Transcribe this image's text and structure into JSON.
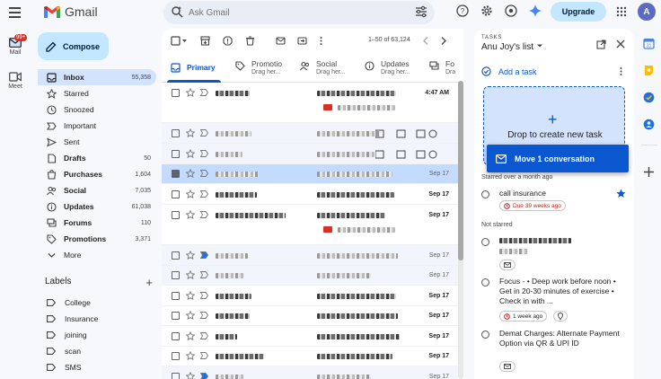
{
  "app": {
    "logo_text": "Gmail",
    "avatar_letter": "A",
    "upgrade_label": "Upgrade"
  },
  "search": {
    "placeholder": "Ask Gmail"
  },
  "rail": {
    "mail_label": "Mail",
    "mail_badge": "99+",
    "meet_label": "Meet"
  },
  "compose_label": "Compose",
  "nav": [
    {
      "label": "Inbox",
      "count": "55,358",
      "icon": "inbox-icon",
      "active": true
    },
    {
      "label": "Starred",
      "count": "",
      "icon": "star-icon"
    },
    {
      "label": "Snoozed",
      "count": "",
      "icon": "clock-icon"
    },
    {
      "label": "Important",
      "count": "",
      "icon": "important-icon"
    },
    {
      "label": "Sent",
      "count": "",
      "icon": "send-icon"
    },
    {
      "label": "Drafts",
      "count": "50",
      "icon": "draft-icon",
      "bold": true
    },
    {
      "label": "Purchases",
      "count": "1,604",
      "icon": "purchases-icon",
      "bold": true
    },
    {
      "label": "Social",
      "count": "7,035",
      "icon": "social-icon",
      "bold": true
    },
    {
      "label": "Updates",
      "count": "61,038",
      "icon": "updates-icon",
      "bold": true
    },
    {
      "label": "Forums",
      "count": "110",
      "icon": "forums-icon",
      "bold": true
    },
    {
      "label": "Promotions",
      "count": "3,371",
      "icon": "promotions-icon",
      "bold": true
    },
    {
      "label": "More",
      "count": "",
      "icon": "chevron-down-icon"
    }
  ],
  "labels": {
    "title": "Labels",
    "items": [
      "College",
      "Insurance",
      "joining",
      "scan",
      "SMS"
    ]
  },
  "toolbar": {
    "pager": "1–50 of 63,124"
  },
  "tabs": [
    {
      "label": "Primary",
      "sub": "",
      "active": true
    },
    {
      "label": "Promotio",
      "sub": "Drag her..."
    },
    {
      "label": "Social",
      "sub": "Drag her..."
    },
    {
      "label": "Updates",
      "sub": "Drag her..."
    },
    {
      "label": "Fo",
      "sub": "Dra"
    }
  ],
  "emails": [
    {
      "date": "4:47 AM",
      "bold": true
    },
    {
      "date": "",
      "bold": false
    },
    {
      "date": "",
      "bold": false
    },
    {
      "date": "Sep 17",
      "bold": false,
      "selected": true
    },
    {
      "date": "Sep 17",
      "bold": true
    },
    {
      "date": "Sep 17",
      "bold": true
    },
    {
      "date": "Sep 17",
      "bold": false
    },
    {
      "date": "Sep 17",
      "bold": false
    },
    {
      "date": "Sep 17",
      "bold": true
    },
    {
      "date": "Sep 17",
      "bold": true
    },
    {
      "date": "Sep 17",
      "bold": true
    },
    {
      "date": "Sep 17",
      "bold": true
    },
    {
      "date": "Sep 17",
      "bold": false
    }
  ],
  "drag": {
    "label": "Move 1 conversation"
  },
  "tasks": {
    "kicker": "TASKS",
    "list_name": "Anu Joy's list",
    "add_label": "Add a task",
    "drop_label": "Drop to create new task",
    "starred_heading": "Starred over a month ago",
    "not_starred_heading": "Not starred",
    "task1": {
      "title": "call insurance",
      "chip": "Due 39 weeks ago"
    },
    "task3": {
      "title": "Focus - • Deep work before noon • Get in 20-30 minutes of exercise  • Check in with ...",
      "chip": "1 week ago"
    },
    "task4": {
      "title": "Demat Charges: Alternate Payment Option via QR & UPI ID"
    }
  },
  "colors": {
    "accent": "#0b57d0",
    "compose_bg": "#c2e7ff",
    "badge": "#d93025",
    "selected_row": "#c2dbff"
  }
}
